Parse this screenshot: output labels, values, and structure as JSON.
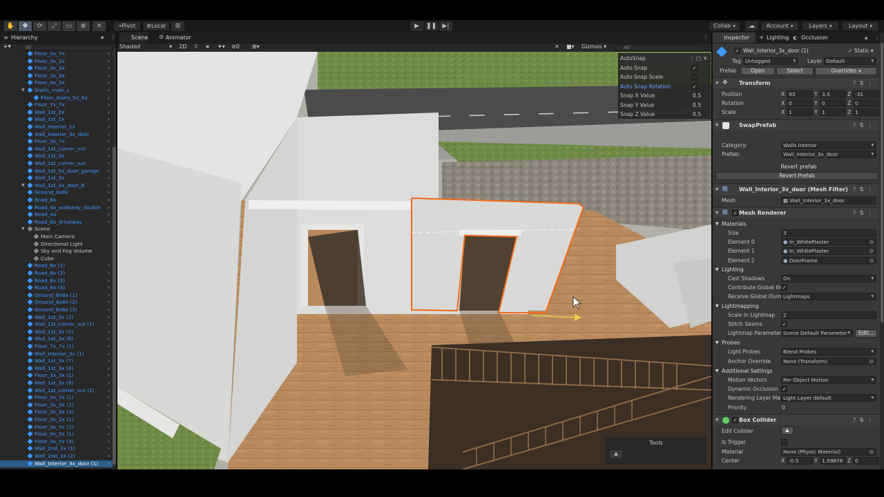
{
  "toolbar": {
    "pivot_label": "Pivot",
    "local_label": "Local",
    "collab_label": "Collab",
    "account_label": "Account",
    "layers_label": "Layers",
    "layout_label": "Layout"
  },
  "hierarchy": {
    "tab_label": "Hierarchy",
    "search_placeholder": "All",
    "items": [
      {
        "label": "Floor_3x_7x",
        "indent": 40,
        "type": "prefab",
        "arrow": true
      },
      {
        "label": "Floor_3x_2x",
        "indent": 40,
        "type": "prefab",
        "arrow": true
      },
      {
        "label": "Floor_3x_3x",
        "indent": 40,
        "type": "prefab",
        "arrow": true
      },
      {
        "label": "Floor_3x_3x",
        "indent": 40,
        "type": "prefab",
        "arrow": true
      },
      {
        "label": "Floor_4x_3x",
        "indent": 40,
        "type": "prefab",
        "arrow": true
      },
      {
        "label": "Stairs_main_L",
        "indent": 40,
        "type": "prefab",
        "arrow": true,
        "fold": true
      },
      {
        "label": "Floor_stairs_5x_4x",
        "indent": 49,
        "type": "prefab",
        "arrow": true
      },
      {
        "label": "Floor_Yx_7x",
        "indent": 40,
        "type": "prefab",
        "arrow": true
      },
      {
        "label": "Wall_1st_2x",
        "indent": 40,
        "type": "prefab",
        "arrow": true
      },
      {
        "label": "Wall_1st_1x",
        "indent": 40,
        "type": "prefab",
        "arrow": true
      },
      {
        "label": "Wall_Interior_1x",
        "indent": 40,
        "type": "prefab",
        "arrow": true
      },
      {
        "label": "Wall_Interior_3x_door",
        "indent": 40,
        "type": "prefab",
        "arrow": true
      },
      {
        "label": "Floor_3x_7x",
        "indent": 40,
        "type": "prefab",
        "arrow": true
      },
      {
        "label": "Wall_1st_corner_out",
        "indent": 40,
        "type": "prefab",
        "arrow": true
      },
      {
        "label": "Wall_1st_3x",
        "indent": 40,
        "type": "prefab",
        "arrow": true
      },
      {
        "label": "Wall_1st_corner_out",
        "indent": 40,
        "type": "prefab",
        "arrow": true
      },
      {
        "label": "Wall_1st_5x_door_garage",
        "indent": 40,
        "type": "prefab",
        "arrow": true
      },
      {
        "label": "Wall_1st_3x",
        "indent": 40,
        "type": "prefab",
        "arrow": true
      },
      {
        "label": "Wall_1st_3x_door_B",
        "indent": 40,
        "type": "prefab",
        "arrow": true,
        "fold": true
      },
      {
        "label": "Ground_8x8x",
        "indent": 40,
        "type": "prefab",
        "arrow": true
      },
      {
        "label": "Road_8x",
        "indent": 40,
        "type": "prefab",
        "arrow": true
      },
      {
        "label": "Road_4x_walkway_double",
        "indent": 40,
        "type": "prefab",
        "arrow": true
      },
      {
        "label": "Road_4x",
        "indent": 40,
        "type": "prefab",
        "arrow": true
      },
      {
        "label": "Road_8x_driveway",
        "indent": 40,
        "type": "prefab",
        "arrow": true
      },
      {
        "label": "Scene",
        "indent": 40,
        "type": "object",
        "arrow": false,
        "fold": true
      },
      {
        "label": "Main Camera",
        "indent": 49,
        "type": "object",
        "arrow": false
      },
      {
        "label": "Directional Light",
        "indent": 49,
        "type": "object",
        "arrow": false
      },
      {
        "label": "Sky and Fog Volume",
        "indent": 49,
        "type": "object",
        "arrow": false
      },
      {
        "label": "Cube",
        "indent": 49,
        "type": "object",
        "arrow": false
      },
      {
        "label": "Road_8x (1)",
        "indent": 40,
        "type": "prefab",
        "arrow": true
      },
      {
        "label": "Road_8x (2)",
        "indent": 40,
        "type": "prefab",
        "arrow": true
      },
      {
        "label": "Road_8x (3)",
        "indent": 40,
        "type": "prefab",
        "arrow": true
      },
      {
        "label": "Road_8x (4)",
        "indent": 40,
        "type": "prefab",
        "arrow": true
      },
      {
        "label": "Ground_8x8x (1)",
        "indent": 40,
        "type": "prefab",
        "arrow": true
      },
      {
        "label": "Ground_8x8x (2)",
        "indent": 40,
        "type": "prefab",
        "arrow": true
      },
      {
        "label": "Ground_8x8x (3)",
        "indent": 40,
        "type": "prefab",
        "arrow": true
      },
      {
        "label": "Wall_1st_3x (2)",
        "indent": 40,
        "type": "prefab",
        "arrow": true
      },
      {
        "label": "Wall_1st_corner_out (1)",
        "indent": 40,
        "type": "prefab",
        "arrow": true
      },
      {
        "label": "Wall_1st_3x (5)",
        "indent": 40,
        "type": "prefab",
        "arrow": true
      },
      {
        "label": "Wall_1st_3x (6)",
        "indent": 40,
        "type": "prefab",
        "arrow": true
      },
      {
        "label": "Floor_7x_7x (1)",
        "indent": 40,
        "type": "prefab",
        "arrow": true
      },
      {
        "label": "Wall_Interior_3x (1)",
        "indent": 40,
        "type": "prefab",
        "arrow": true
      },
      {
        "label": "Wall_1st_3x (7)",
        "indent": 40,
        "type": "prefab",
        "arrow": true
      },
      {
        "label": "Wall_1st_3x (8)",
        "indent": 40,
        "type": "prefab",
        "arrow": true
      },
      {
        "label": "Floor_3x_3x (1)",
        "indent": 40,
        "type": "prefab",
        "arrow": true
      },
      {
        "label": "Wall_1st_3x (9)",
        "indent": 40,
        "type": "prefab",
        "arrow": true
      },
      {
        "label": "Wall_1st_corner_out (2)",
        "indent": 40,
        "type": "prefab",
        "arrow": true
      },
      {
        "label": "Floor_3x_Yx (1)",
        "indent": 40,
        "type": "prefab",
        "arrow": true
      },
      {
        "label": "Floor_3x_3x (2)",
        "indent": 40,
        "type": "prefab",
        "arrow": true
      },
      {
        "label": "Floor_3x_3x (3)",
        "indent": 40,
        "type": "prefab",
        "arrow": true
      },
      {
        "label": "Floor_3x_2x (1)",
        "indent": 40,
        "type": "prefab",
        "arrow": true
      },
      {
        "label": "Floor_3x_Yx (2)",
        "indent": 40,
        "type": "prefab",
        "arrow": true
      },
      {
        "label": "Floor_4x_3x (1)",
        "indent": 40,
        "type": "prefab",
        "arrow": true
      },
      {
        "label": "Floor_3x_Yx (3)",
        "indent": 40,
        "type": "prefab",
        "arrow": true
      },
      {
        "label": "Wall_2nd_3x (1)",
        "indent": 40,
        "type": "prefab",
        "arrow": true
      },
      {
        "label": "Wall_2nd_3x (2)",
        "indent": 40,
        "type": "prefab",
        "arrow": true
      },
      {
        "label": "Wall_Interior_3x_door (1)",
        "indent": 40,
        "type": "prefab",
        "arrow": true,
        "selected": true
      }
    ]
  },
  "scene": {
    "tab_scene": "Scene",
    "tab_animator": "Animator",
    "shading_mode": "Shaded",
    "mode_2d": "2D",
    "hidden_count": "0",
    "gizmos_label": "Gizmos",
    "search_placeholder": "All",
    "autosnap": {
      "title": "AutoSnap",
      "rows": [
        {
          "label": "Auto Snap",
          "checked": true,
          "highlight": false
        },
        {
          "label": "Auto Snap Scale",
          "checked": false,
          "highlight": false
        },
        {
          "label": "Auto Snap Rotation",
          "checked": true,
          "highlight": true
        },
        {
          "label": "Snap X Value",
          "value": "0.5"
        },
        {
          "label": "Snap Y Value",
          "value": "0.5"
        },
        {
          "label": "Snap Z Value",
          "value": "0.5"
        }
      ]
    },
    "tools_overlay_title": "Tools"
  },
  "inspector": {
    "tabs": [
      "Inspector",
      "Lighting",
      "Occlusion"
    ],
    "object_name": "Wall_Interior_3x_door (1)",
    "static_label": "Static",
    "tag_label": "Tag",
    "tag_value": "Untagged",
    "layer_label": "Layer",
    "layer_value": "Default",
    "prefab_label": "Prefab",
    "open_button": "Open",
    "select_button": "Select",
    "overrides_button": "Overrides",
    "transform": {
      "title": "Transform",
      "position_label": "Position",
      "pos_x": "93",
      "pos_y": "3.5",
      "pos_z": "-31",
      "rotation_label": "Rotation",
      "rot_x": "0",
      "rot_y": "0",
      "rot_z": "0",
      "scale_label": "Scale",
      "scl_x": "1",
      "scl_y": "1",
      "scl_z": "1"
    },
    "swap_prefab": {
      "title": "SwapPrefab",
      "category_label": "Category:",
      "category_value": "Walls Interior",
      "prefab_label": "Prefab:",
      "prefab_value": "Wall_Interior_3x_door",
      "revert_text": "Revert prefab",
      "revert_button": "Revert Prefab"
    },
    "mesh_filter": {
      "title": "Wall_Interior_3x_door (Mesh Filter)",
      "mesh_label": "Mesh",
      "mesh_value": "Wall_Interior_3x_door"
    },
    "mesh_renderer": {
      "title": "Mesh Renderer",
      "materials_label": "Materials",
      "size_label": "Size",
      "size_value": "3",
      "elements": [
        {
          "label": "Element 0",
          "value": "In_WhitePlaster"
        },
        {
          "label": "Element 1",
          "value": "In_WhitePlaster"
        },
        {
          "label": "Element 2",
          "value": "DoorFrame"
        }
      ],
      "lighting_label": "Lighting",
      "cast_shadows_label": "Cast Shadows",
      "cast_shadows_value": "On",
      "contribute_gi_label": "Contribute Global Illu",
      "receive_gi_label": "Receive Global Illum",
      "receive_gi_value": "Lightmaps",
      "lightmapping_label": "Lightmapping",
      "scale_lightmap_label": "Scale In Lightmap",
      "scale_lightmap_value": "2",
      "stitch_seams_label": "Stitch Seams",
      "lightmap_param_label": "Lightmap Parameter",
      "lightmap_param_value": "Scene Default Parameter",
      "edit_button": "Edit...",
      "probes_label": "Probes",
      "light_probes_label": "Light Probes",
      "light_probes_value": "Blend Probes",
      "anchor_override_label": "Anchor Override",
      "anchor_override_value": "None (Transform)",
      "additional_label": "Additional Settings",
      "motion_vectors_label": "Motion Vectors",
      "motion_vectors_value": "Per Object Motion",
      "dynamic_occlusion_label": "Dynamic Occlusion",
      "rendering_layer_label": "Rendering Layer Ma",
      "rendering_layer_value": "Light Layer default",
      "priority_label": "Priority",
      "priority_value": "0"
    },
    "box_collider": {
      "title": "Box Collider",
      "edit_collider_label": "Edit Collider",
      "is_trigger_label": "Is Trigger",
      "material_label": "Material",
      "material_value": "None (Physic Material)",
      "center_label": "Center",
      "center_x": "-0.5",
      "center_y": "1.59876",
      "center_z": "0"
    }
  }
}
